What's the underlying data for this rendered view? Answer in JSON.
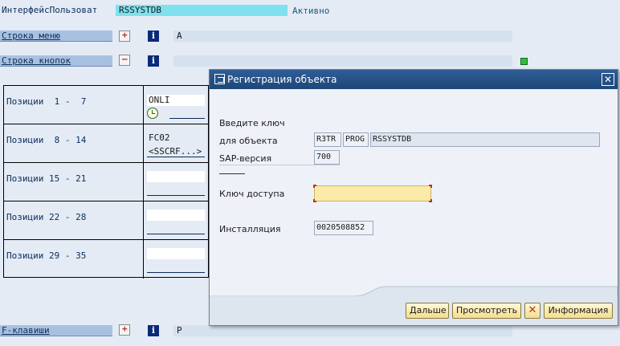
{
  "header": {
    "interface_label": "ИнтерфейсПользоват",
    "interface_value": "RSSYSTDB",
    "status": "Активно"
  },
  "rows": {
    "menu_label": "Строка меню",
    "menu_value": "A",
    "buttons_label": "Строка кнопок",
    "buttons_value": "",
    "fkeys_label": "F-клавиши",
    "fkeys_value": "P"
  },
  "positions": [
    {
      "label": "Позиции  1 -  7",
      "slot1": "ONLI",
      "slot2": ""
    },
    {
      "label": "Позиции  8 - 14",
      "slot1": "FC02",
      "slot2": "<SSCRF...>"
    },
    {
      "label": "Позиции 15 - 21",
      "slot1": "",
      "slot2": ""
    },
    {
      "label": "Позиции 22 - 28",
      "slot1": "",
      "slot2": ""
    },
    {
      "label": "Позиции 29 - 35",
      "slot1": "",
      "slot2": ""
    }
  ],
  "dialog": {
    "title": "Регистрация объекта",
    "enter_key": "Введите ключ",
    "for_object": "для объекта",
    "object_r3tr": "R3TR",
    "object_prog": "PROG",
    "object_name": "RSSYSTDB",
    "sap_version_label": "SAP-версия",
    "sap_version": "700",
    "access_key_label": "Ключ доступа",
    "access_key": "",
    "installation_label": "Инсталляция",
    "installation": "0020508852",
    "buttons": {
      "next": "Дальше",
      "view": "Просмотреть",
      "info": "Информация"
    }
  },
  "icons": {
    "expand": "expand-icon",
    "info": "info-icon",
    "collapse": "collapse-icon",
    "status_light": "green-status-icon",
    "clock": "clock-icon",
    "close": "close-icon",
    "cancel": "cancel-x-icon"
  }
}
